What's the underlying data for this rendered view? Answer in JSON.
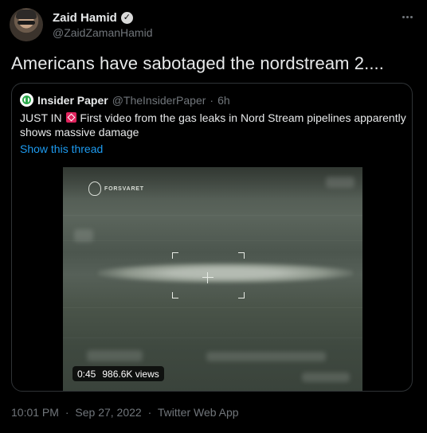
{
  "author": {
    "display_name": "Zaid Hamid",
    "verified_badge": "✓",
    "handle": "@ZaidZamanHamid"
  },
  "more_options_icon": "ellipsis-icon",
  "tweet": {
    "text": "Americans have sabotaged the nordstream 2...."
  },
  "quoted_tweet": {
    "display_name": "Insider Paper",
    "handle": "@TheInsiderPaper",
    "separator": "·",
    "time": "6h",
    "text_before_emoji": "JUST IN ",
    "text_after_emoji": " First video from the gas leaks in Nord Stream pipelines apparently shows massive damage",
    "show_thread": "Show this thread",
    "video": {
      "watermark": "FORSVARET",
      "duration": "0:45",
      "views": "986.6K views"
    }
  },
  "meta": {
    "time": "10:01 PM",
    "sep1": "·",
    "date": "Sep 27, 2022",
    "sep2": "·",
    "source": "Twitter Web App"
  },
  "colors": {
    "background": "#000000",
    "text": "#e7e9ea",
    "secondary": "#71767b",
    "link": "#1d9bf0",
    "border": "#2f3336",
    "emoji": "#e0245e"
  }
}
